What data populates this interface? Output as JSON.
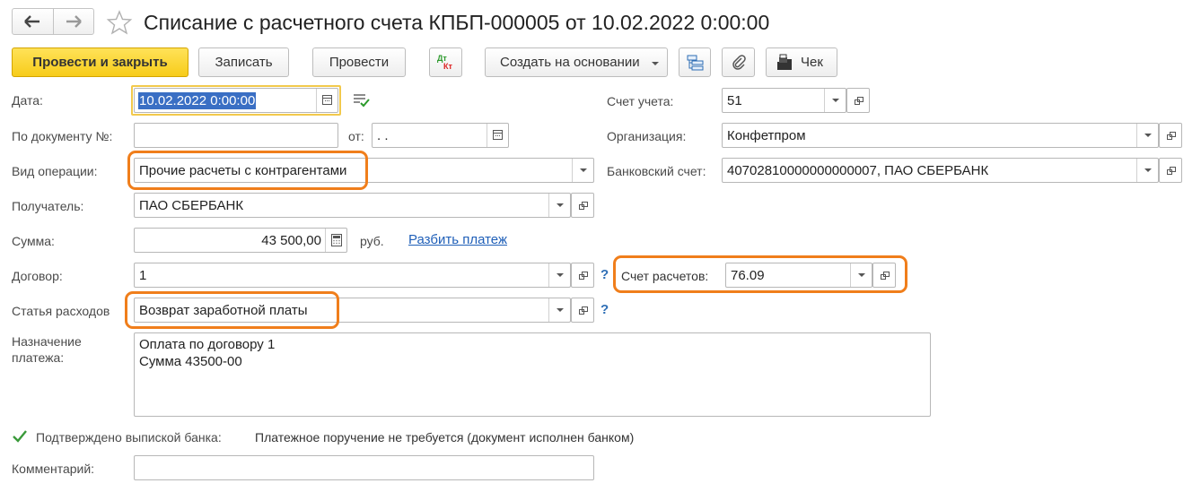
{
  "header": {
    "title": "Списание с расчетного счета КПБП-000005 от 10.02.2022 0:00:00"
  },
  "toolbar": {
    "post_close": "Провести и закрыть",
    "save": "Записать",
    "post": "Провести",
    "dt_label": "Дт",
    "kt_label": "Кт",
    "create_based": "Создать на основании",
    "check": "Чек"
  },
  "form": {
    "date_label": "Дата:",
    "date_value": "10.02.2022  0:00:00",
    "doc_no_label": "По документу №:",
    "doc_no_value": "",
    "doc_from_label": "от:",
    "doc_from_value": " .  .",
    "operation_label": "Вид операции:",
    "operation_value": "Прочие расчеты с контрагентами",
    "recipient_label": "Получатель:",
    "recipient_value": "ПАО СБЕРБАНК",
    "amount_label": "Сумма:",
    "amount_value": "43 500,00",
    "currency": "руб.",
    "split_link": "Разбить платеж",
    "contract_label": "Договор:",
    "contract_value": "1",
    "contract_help": "?",
    "expense_label": "Статья расходов",
    "expense_value": "Возврат заработной платы",
    "expense_help": "?",
    "purpose_label_1": "Назначение",
    "purpose_label_2": "платежа:",
    "purpose_line_1": "Оплата по договору 1",
    "purpose_line_2": "Сумма 43500-00",
    "confirmed_label": "Подтверждено выпиской банка:",
    "confirmed_status": "Платежное поручение не требуется (документ исполнен банком)",
    "comment_label": "Комментарий:",
    "comment_value": "",
    "account_label": "Счет учета:",
    "account_value": "51",
    "org_label": "Организация:",
    "org_value": "Конфетпром",
    "bank_account_label": "Банковский счет:",
    "bank_account_value": "40702810000000000007, ПАО СБЕРБАНК",
    "settlement_label": "Счет расчетов:",
    "settlement_value": "76.09"
  },
  "colors": {
    "highlight": "#f07e1b",
    "primary_button": "#f7cc1a",
    "link": "#1f5fb8",
    "check_green": "#3a9a3a"
  }
}
